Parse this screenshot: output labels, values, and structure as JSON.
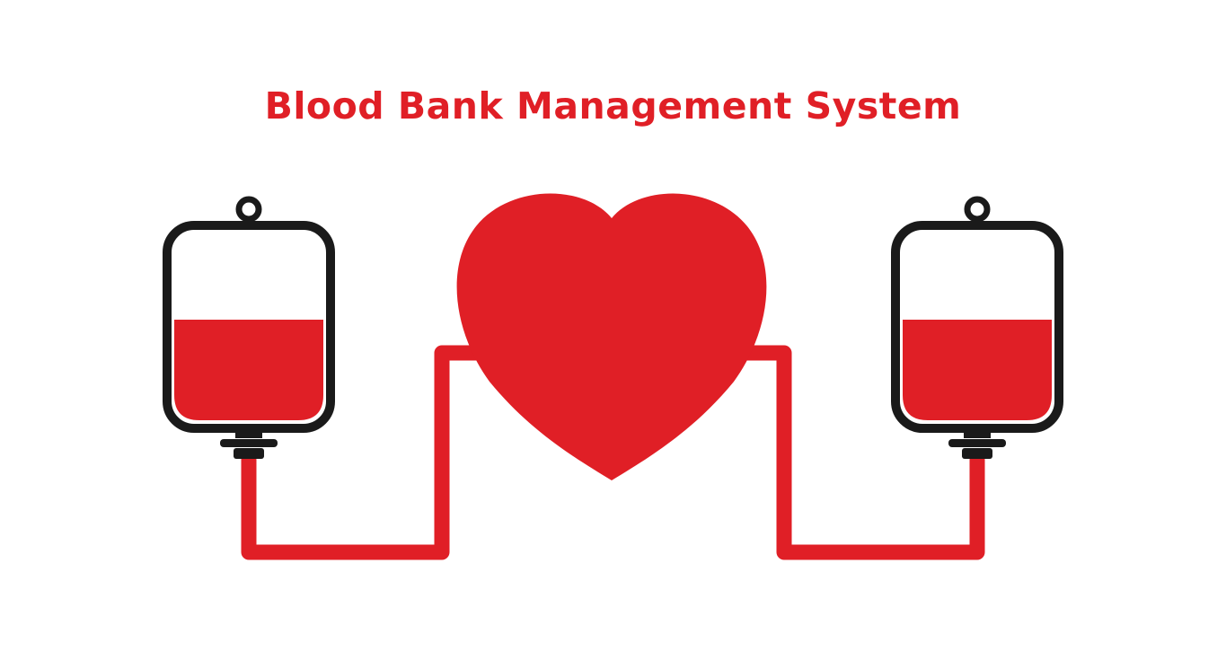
{
  "title": "Blood Bank Management System",
  "colors": {
    "blood": "#e01f26",
    "outline": "#1a1a1a",
    "background": "#ffffff"
  },
  "icons": {
    "left_bag": "blood-bag-icon",
    "right_bag": "blood-bag-icon",
    "center": "heart-icon",
    "tube": "transfusion-tube"
  },
  "levels": {
    "left_bag_fill_fraction": 0.55,
    "right_bag_fill_fraction": 0.55
  }
}
